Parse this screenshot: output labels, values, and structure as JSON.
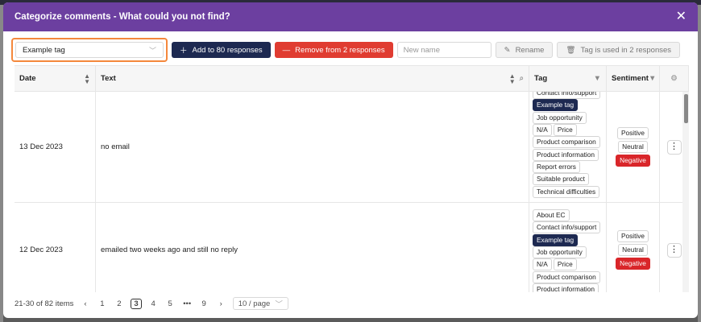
{
  "modal": {
    "title": "Categorize comments - What could you not find?",
    "close_icon": "close-icon"
  },
  "toolbar": {
    "selected_tag": "Example tag",
    "add_label": "Add to 80 responses",
    "remove_label": "Remove from 2 responses",
    "new_name_placeholder": "New name",
    "rename_label": "Rename",
    "used_label": "Tag is used in 2 responses"
  },
  "table": {
    "headers": {
      "date": "Date",
      "text": "Text",
      "tag": "Tag",
      "sentiment": "Sentiment"
    },
    "rows": [
      {
        "date": "13 Dec 2023",
        "text": "no email",
        "tags": [
          [
            "Contact info/support"
          ],
          [
            "Example tag"
          ],
          [
            "Job opportunity"
          ],
          [
            "N/A",
            "Price"
          ],
          [
            "Product comparison"
          ],
          [
            "Product information"
          ],
          [
            "Report errors"
          ],
          [
            "Suitable product"
          ],
          [
            "Technical difficulties"
          ]
        ],
        "sentiment": [
          "Positive",
          "Neutral",
          "Negative"
        ]
      },
      {
        "date": "12 Dec 2023",
        "text": "emailed two weeks ago and still no reply",
        "tags": [
          [
            "About EC"
          ],
          [
            "Contact info/support"
          ],
          [
            "Example tag"
          ],
          [
            "Job opportunity"
          ],
          [
            "N/A",
            "Price"
          ],
          [
            "Product comparison"
          ],
          [
            "Product information"
          ]
        ],
        "sentiment": [
          "Positive",
          "Neutral",
          "Negative"
        ]
      }
    ]
  },
  "pagination": {
    "range": "21-30 of 82 items",
    "pages": [
      "1",
      "2",
      "3",
      "4",
      "5",
      "•••",
      "9"
    ],
    "current": "3",
    "page_size": "10 / page"
  },
  "colors": {
    "header": "#6c3fa0",
    "navy": "#1d2951",
    "red": "#e03c31",
    "orange_focus": "#f4883c"
  }
}
